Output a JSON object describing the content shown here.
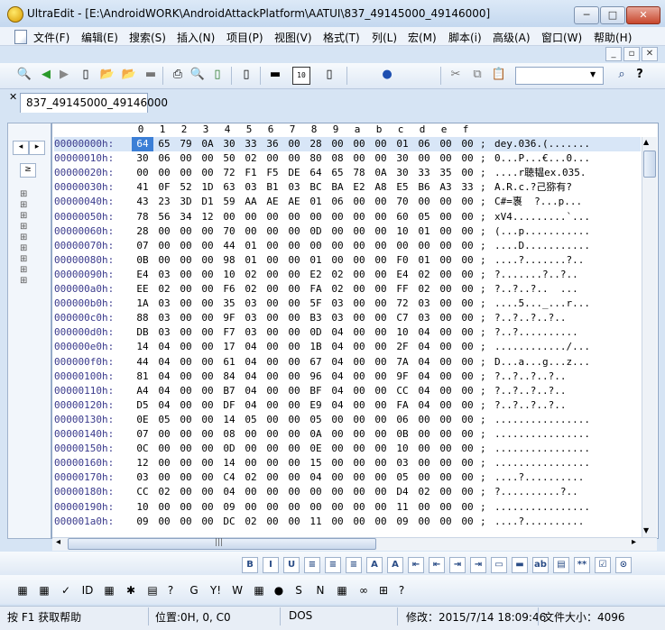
{
  "window": {
    "title": "UltraEdit - [E:\\AndroidWORK\\AndroidAttackPlatform\\AATUI\\837_49145000_49146000]",
    "min_glyph": "─",
    "max_glyph": "□",
    "close_glyph": "✕"
  },
  "menu": {
    "items": [
      "文件(F)",
      "编辑(E)",
      "搜索(S)",
      "插入(N)",
      "项目(P)",
      "视图(V)",
      "格式(T)",
      "列(L)",
      "宏(M)",
      "脚本(i)",
      "高级(A)",
      "窗口(W)",
      "帮助(H)"
    ],
    "mdi_min": "_",
    "mdi_restore": "▫",
    "mdi_close": "✕"
  },
  "tabs": [
    {
      "label": "837_49145000_49146000"
    }
  ],
  "tab_close_glyph": "✕",
  "left_panel": {
    "nav_left": "◂",
    "nav_right": "▸",
    "expand": "≥"
  },
  "editor": {
    "column_header": [
      "0",
      "1",
      "2",
      "3",
      "4",
      "5",
      "6",
      "7",
      "8",
      "9",
      "a",
      "b",
      "c",
      "d",
      "e",
      "f"
    ],
    "rows": [
      {
        "addr": "00000000h:",
        "hex": [
          "64",
          "65",
          "79",
          "0A",
          "30",
          "33",
          "36",
          "00",
          "28",
          "00",
          "00",
          "00",
          "01",
          "06",
          "00",
          "00"
        ],
        "ascii": "dey.036.(......."
      },
      {
        "addr": "00000010h:",
        "hex": [
          "30",
          "06",
          "00",
          "00",
          "50",
          "02",
          "00",
          "00",
          "80",
          "08",
          "00",
          "00",
          "30",
          "00",
          "00",
          "00"
        ],
        "ascii": "0...P...€...0..."
      },
      {
        "addr": "00000020h:",
        "hex": [
          "00",
          "00",
          "00",
          "00",
          "72",
          "F1",
          "F5",
          "DE",
          "64",
          "65",
          "78",
          "0A",
          "30",
          "33",
          "35",
          "00"
        ],
        "ascii": "....r聴韫ex.035."
      },
      {
        "addr": "00000030h:",
        "hex": [
          "41",
          "0F",
          "52",
          "1D",
          "63",
          "03",
          "B1",
          "03",
          "BC",
          "BA",
          "E2",
          "A8",
          "E5",
          "B6",
          "A3",
          "33"
        ],
        "ascii": "A.R.c.?己猕有?"
      },
      {
        "addr": "00000040h:",
        "hex": [
          "43",
          "23",
          "3D",
          "D1",
          "59",
          "AA",
          "AE",
          "AE",
          "01",
          "06",
          "00",
          "00",
          "70",
          "00",
          "00",
          "00"
        ],
        "ascii": "C#=褢  ?...p..."
      },
      {
        "addr": "00000050h:",
        "hex": [
          "78",
          "56",
          "34",
          "12",
          "00",
          "00",
          "00",
          "00",
          "00",
          "00",
          "00",
          "00",
          "60",
          "05",
          "00",
          "00"
        ],
        "ascii": "xV4.........`..."
      },
      {
        "addr": "00000060h:",
        "hex": [
          "28",
          "00",
          "00",
          "00",
          "70",
          "00",
          "00",
          "00",
          "0D",
          "00",
          "00",
          "00",
          "10",
          "01",
          "00",
          "00"
        ],
        "ascii": "(...p..........."
      },
      {
        "addr": "00000070h:",
        "hex": [
          "07",
          "00",
          "00",
          "00",
          "44",
          "01",
          "00",
          "00",
          "00",
          "00",
          "00",
          "00",
          "00",
          "00",
          "00",
          "00"
        ],
        "ascii": "....D..........."
      },
      {
        "addr": "00000080h:",
        "hex": [
          "0B",
          "00",
          "00",
          "00",
          "98",
          "01",
          "00",
          "00",
          "01",
          "00",
          "00",
          "00",
          "F0",
          "01",
          "00",
          "00"
        ],
        "ascii": "....?.......?.."
      },
      {
        "addr": "00000090h:",
        "hex": [
          "E4",
          "03",
          "00",
          "00",
          "10",
          "02",
          "00",
          "00",
          "E2",
          "02",
          "00",
          "00",
          "E4",
          "02",
          "00",
          "00"
        ],
        "ascii": "?.......?..?.."
      },
      {
        "addr": "000000a0h:",
        "hex": [
          "EE",
          "02",
          "00",
          "00",
          "F6",
          "02",
          "00",
          "00",
          "FA",
          "02",
          "00",
          "00",
          "FF",
          "02",
          "00",
          "00"
        ],
        "ascii": "?..?..?..  ..."
      },
      {
        "addr": "000000b0h:",
        "hex": [
          "1A",
          "03",
          "00",
          "00",
          "35",
          "03",
          "00",
          "00",
          "5F",
          "03",
          "00",
          "00",
          "72",
          "03",
          "00",
          "00"
        ],
        "ascii": "....5..._...r..."
      },
      {
        "addr": "000000c0h:",
        "hex": [
          "88",
          "03",
          "00",
          "00",
          "9F",
          "03",
          "00",
          "00",
          "B3",
          "03",
          "00",
          "00",
          "C7",
          "03",
          "00",
          "00"
        ],
        "ascii": "?..?..?..?.."
      },
      {
        "addr": "000000d0h:",
        "hex": [
          "DB",
          "03",
          "00",
          "00",
          "F7",
          "03",
          "00",
          "00",
          "0D",
          "04",
          "00",
          "00",
          "10",
          "04",
          "00",
          "00"
        ],
        "ascii": "?..?.........."
      },
      {
        "addr": "000000e0h:",
        "hex": [
          "14",
          "04",
          "00",
          "00",
          "17",
          "04",
          "00",
          "00",
          "1B",
          "04",
          "00",
          "00",
          "2F",
          "04",
          "00",
          "00"
        ],
        "ascii": "............/..."
      },
      {
        "addr": "000000f0h:",
        "hex": [
          "44",
          "04",
          "00",
          "00",
          "61",
          "04",
          "00",
          "00",
          "67",
          "04",
          "00",
          "00",
          "7A",
          "04",
          "00",
          "00"
        ],
        "ascii": "D...a...g...z..."
      },
      {
        "addr": "00000100h:",
        "hex": [
          "81",
          "04",
          "00",
          "00",
          "84",
          "04",
          "00",
          "00",
          "96",
          "04",
          "00",
          "00",
          "9F",
          "04",
          "00",
          "00"
        ],
        "ascii": "?..?..?..?.."
      },
      {
        "addr": "00000110h:",
        "hex": [
          "A4",
          "04",
          "00",
          "00",
          "B7",
          "04",
          "00",
          "00",
          "BF",
          "04",
          "00",
          "00",
          "CC",
          "04",
          "00",
          "00"
        ],
        "ascii": "?..?..?..?.."
      },
      {
        "addr": "00000120h:",
        "hex": [
          "D5",
          "04",
          "00",
          "00",
          "DF",
          "04",
          "00",
          "00",
          "E9",
          "04",
          "00",
          "00",
          "FA",
          "04",
          "00",
          "00"
        ],
        "ascii": "?..?..?..?.."
      },
      {
        "addr": "00000130h:",
        "hex": [
          "0E",
          "05",
          "00",
          "00",
          "14",
          "05",
          "00",
          "00",
          "05",
          "00",
          "00",
          "00",
          "06",
          "00",
          "00",
          "00"
        ],
        "ascii": "................"
      },
      {
        "addr": "00000140h:",
        "hex": [
          "07",
          "00",
          "00",
          "00",
          "08",
          "00",
          "00",
          "00",
          "0A",
          "00",
          "00",
          "00",
          "0B",
          "00",
          "00",
          "00"
        ],
        "ascii": "................"
      },
      {
        "addr": "00000150h:",
        "hex": [
          "0C",
          "00",
          "00",
          "00",
          "0D",
          "00",
          "00",
          "00",
          "0E",
          "00",
          "00",
          "00",
          "10",
          "00",
          "00",
          "00"
        ],
        "ascii": "................"
      },
      {
        "addr": "00000160h:",
        "hex": [
          "12",
          "00",
          "00",
          "00",
          "14",
          "00",
          "00",
          "00",
          "15",
          "00",
          "00",
          "00",
          "03",
          "00",
          "00",
          "00"
        ],
        "ascii": "................"
      },
      {
        "addr": "00000170h:",
        "hex": [
          "03",
          "00",
          "00",
          "00",
          "C4",
          "02",
          "00",
          "00",
          "04",
          "00",
          "00",
          "00",
          "05",
          "00",
          "00",
          "00"
        ],
        "ascii": "....?.........."
      },
      {
        "addr": "00000180h:",
        "hex": [
          "CC",
          "02",
          "00",
          "00",
          "04",
          "00",
          "00",
          "00",
          "00",
          "00",
          "00",
          "00",
          "D4",
          "02",
          "00",
          "00"
        ],
        "ascii": "?..........?.."
      },
      {
        "addr": "00000190h:",
        "hex": [
          "10",
          "00",
          "00",
          "00",
          "09",
          "00",
          "00",
          "00",
          "00",
          "00",
          "00",
          "00",
          "11",
          "00",
          "00",
          "00"
        ],
        "ascii": "................"
      },
      {
        "addr": "000001a0h:",
        "hex": [
          "09",
          "00",
          "00",
          "00",
          "DC",
          "02",
          "00",
          "00",
          "11",
          "00",
          "00",
          "00",
          "09",
          "00",
          "00",
          "00"
        ],
        "ascii": "....?.........."
      }
    ]
  },
  "scroll_glyphs": {
    "up": "▲",
    "down": "▼",
    "left": "◂",
    "right": "▸",
    "grip": "|||"
  },
  "toolbar_glyphs": {
    "new": "▯",
    "open": "📂",
    "save": "▬",
    "print": "⎙",
    "find": "🔍",
    "help": "?",
    "back": "◀",
    "forward": "▶",
    "cut": "✂",
    "copy": "⧉",
    "paste": "📋",
    "binoculars": "⌕"
  },
  "format_glyphs": [
    "B",
    "I",
    "U",
    "≡",
    "≡",
    "≡",
    "A",
    "A",
    "⇤",
    "⇤",
    "⇥",
    "⇥",
    "▭",
    "▬",
    "ab",
    "▤",
    "**",
    "☑",
    "⊙"
  ],
  "bottom_glyphs": [
    "▦",
    "▦",
    "✓",
    "ID",
    "▦",
    "✱",
    "▤",
    "?",
    "G",
    "Y!",
    "W",
    "▦",
    "●",
    "S",
    "N",
    "▦",
    "∞",
    "⊞",
    "?"
  ],
  "status": {
    "help": "按 F1 获取帮助",
    "position": "位置:0H, 0, C0",
    "format": "DOS",
    "modified": "修改：2015/7/14 18:09:46",
    "filesize": "文件大小：4096"
  }
}
